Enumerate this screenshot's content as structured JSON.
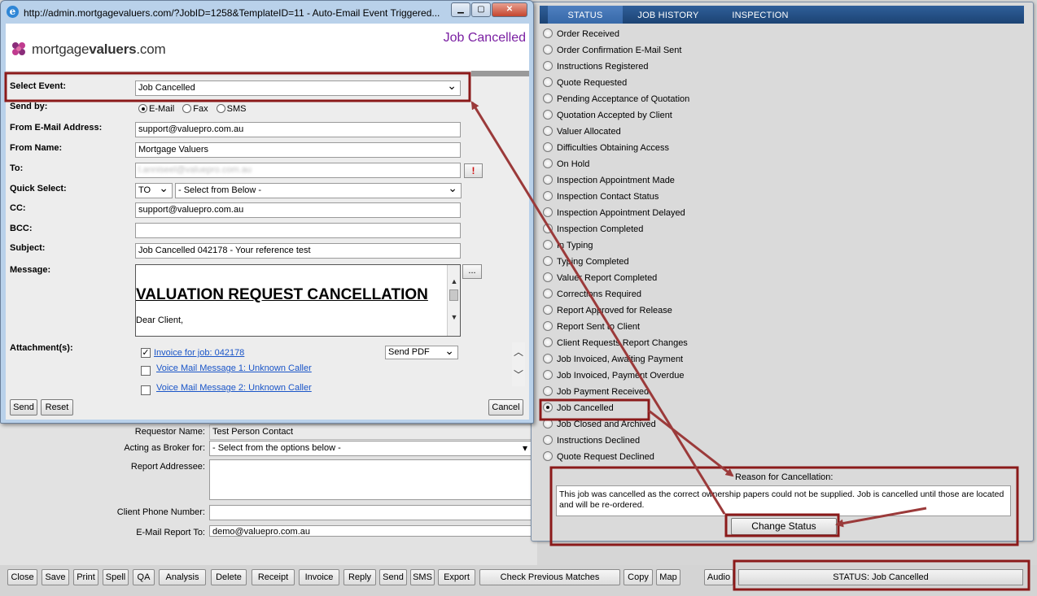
{
  "background_form": {
    "requestor_label": "Requestor Name:",
    "requestor_value": "Test Person Contact",
    "broker_label": "Acting as Broker for:",
    "broker_value": "- Select from the options below -",
    "addressee_label": "Report Addressee:",
    "phone_label": "Client Phone Number:",
    "email_report_label": "E-Mail Report To:",
    "email_report_value": "demo@valuepro.com.au"
  },
  "toolbar": {
    "buttons": [
      "Close",
      "Save",
      "Print",
      "Spell",
      "QA",
      "Analysis",
      "Delete",
      "Receipt",
      "Invoice",
      "Reply",
      "Send",
      "SMS",
      "Export",
      "Check Previous Matches",
      "Copy",
      "Map",
      "Audio"
    ],
    "status_text": "STATUS: Job Cancelled"
  },
  "status_panel": {
    "tabs": [
      "STATUS",
      "JOB HISTORY",
      "INSPECTION"
    ],
    "active_tab": "STATUS",
    "options": [
      "Order Received",
      "Order Confirmation E-Mail Sent",
      "Instructions Registered",
      "Quote Requested",
      "Pending Acceptance of Quotation",
      "Quotation Accepted by Client",
      "Valuer Allocated",
      "Difficulties Obtaining Access",
      "On Hold",
      "Inspection Appointment Made",
      "Inspection Contact Status",
      "Inspection Appointment Delayed",
      "Inspection Completed",
      "In Typing",
      "Typing Completed",
      "Valuer Report Completed",
      "Corrections Required",
      "Report Approved for Release",
      "Report Sent to Client",
      "Client Requests Report Changes",
      "Job Invoiced, Awaiting Payment",
      "Job Invoiced, Payment Overdue",
      "Job Payment Received",
      "Job Cancelled",
      "Job Closed and Archived",
      "Instructions Declined",
      "Quote Request Declined"
    ],
    "selected": "Job Cancelled",
    "reason_label": "Reason for Cancellation:",
    "reason_text": "This job was cancelled as the correct ownership papers could not be supplied. Job is cancelled until those are located and will be re-ordered.",
    "change_button": "Change Status"
  },
  "popup": {
    "title": "http://admin.mortgagevaluers.com/?JobID=1258&TemplateID=11 - Auto-Email Event Triggered...",
    "logo_text_a": "mortgage",
    "logo_text_b": "valuers",
    "logo_text_c": ".com",
    "job_status": "Job Cancelled",
    "select_event_label": "Select Event:",
    "select_event_value": "Job Cancelled",
    "send_by_label": "Send by:",
    "send_by_options": [
      "E-Mail",
      "Fax",
      "SMS"
    ],
    "send_by_selected": "E-Mail",
    "from_email_label": "From E-Mail Address:",
    "from_email_value": "support@valuepro.com.au",
    "from_name_label": "From Name:",
    "from_name_value": "Mortgage Valuers",
    "to_label": "To:",
    "to_value": "l.anniseel@valuepro.com.au",
    "to_alert": "!",
    "quick_select_label": "Quick Select:",
    "quick_select_type": "TO",
    "quick_select_value": "- Select from Below -",
    "cc_label": "CC:",
    "cc_value": "support@valuepro.com.au",
    "bcc_label": "BCC:",
    "subject_label": "Subject:",
    "subject_value": "Job Cancelled 042178 - Your reference test",
    "message_label": "Message:",
    "message_heading": "VALUATION REQUEST CANCELLATION",
    "message_line": "Dear Client,",
    "more_button": "...",
    "attachments_label": "Attachment(s):",
    "attachments": [
      {
        "label": "Invoice for job: 042178",
        "checked": true
      },
      {
        "label": "Voice Mail Message 1: Unknown Caller",
        "checked": false
      },
      {
        "label": "Voice Mail Message 2: Unknown Caller",
        "checked": false
      }
    ],
    "send_pdf": "Send PDF",
    "send_button": "Send",
    "reset_button": "Reset",
    "cancel_button": "Cancel"
  },
  "colors": {
    "annotation": "#8b1a1a",
    "tab_bar": "#1c4373",
    "job_status": "#7a1fa2",
    "link": "#1a55c8"
  }
}
